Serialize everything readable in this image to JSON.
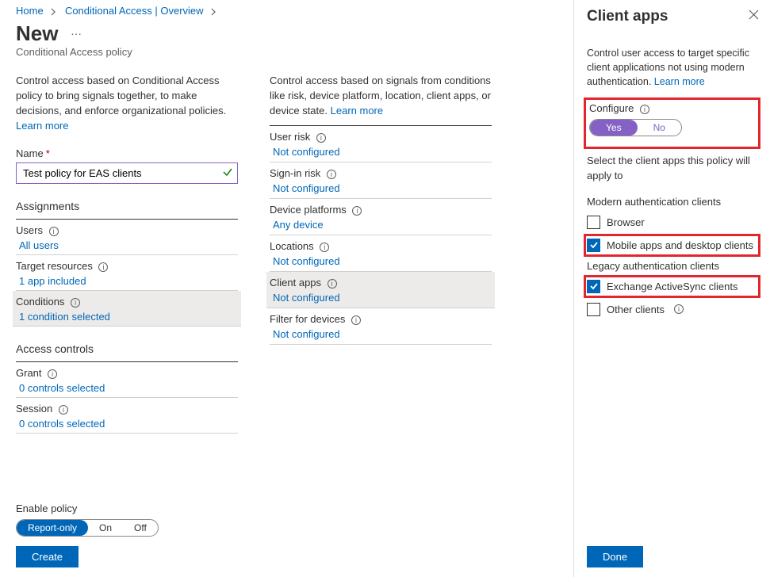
{
  "breadcrumb": {
    "home": "Home",
    "ca": "Conditional Access | Overview"
  },
  "title": "New",
  "subtitle": "Conditional Access policy",
  "col1": {
    "intro": "Control access based on Conditional Access policy to bring signals together, to make decisions, and enforce organizational policies.",
    "learn": "Learn more",
    "name_label": "Name",
    "name_value": "Test policy for EAS clients",
    "assignments_hdr": "Assignments",
    "users_label": "Users",
    "users_link": "All users",
    "target_label": "Target resources",
    "target_link": "1 app included",
    "cond_label": "Conditions",
    "cond_link": "1 condition selected",
    "access_hdr": "Access controls",
    "grant_label": "Grant",
    "grant_link": "0 controls selected",
    "session_label": "Session",
    "session_link": "0 controls selected"
  },
  "col2": {
    "intro": "Control access based on signals from conditions like risk, device platform, location, client apps, or device state.",
    "learn": "Learn more",
    "items": [
      {
        "label": "User risk",
        "value": "Not configured"
      },
      {
        "label": "Sign-in risk",
        "value": "Not configured"
      },
      {
        "label": "Device platforms",
        "value": "Any device"
      },
      {
        "label": "Locations",
        "value": "Not configured"
      },
      {
        "label": "Client apps",
        "value": "Not configured"
      },
      {
        "label": "Filter for devices",
        "value": "Not configured"
      }
    ]
  },
  "bottom": {
    "enable_label": "Enable policy",
    "opts": [
      "Report-only",
      "On",
      "Off"
    ],
    "create": "Create"
  },
  "panel": {
    "title": "Client apps",
    "desc": "Control user access to target specific client applications not using modern authentication.",
    "learn": "Learn more",
    "configure": "Configure",
    "yes": "Yes",
    "no": "No",
    "select_msg": "Select the client apps this policy will apply to",
    "modern_hdr": "Modern authentication clients",
    "legacy_hdr": "Legacy authentication clients",
    "browser": "Browser",
    "mobile": "Mobile apps and desktop clients",
    "eas": "Exchange ActiveSync clients",
    "other": "Other clients",
    "done": "Done"
  }
}
